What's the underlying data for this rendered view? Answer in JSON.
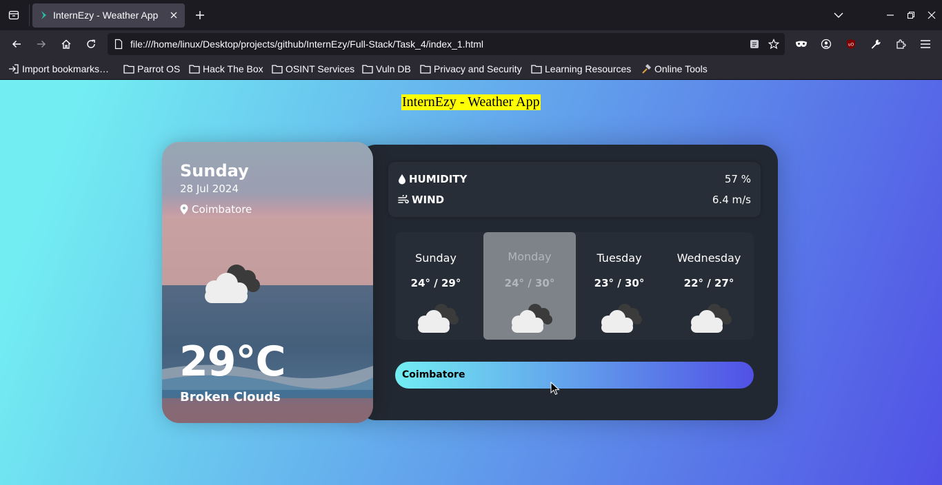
{
  "browser": {
    "tab_title": "InternEzy - Weather App",
    "url": "file:///home/linux/Desktop/projects/github/InternEzy/Full-Stack/Task_4/index_1.html",
    "bookmarks": [
      {
        "label": "Import bookmarks…"
      },
      {
        "label": "Parrot OS"
      },
      {
        "label": "Hack The Box"
      },
      {
        "label": "OSINT Services"
      },
      {
        "label": "Vuln DB"
      },
      {
        "label": "Privacy and Security"
      },
      {
        "label": "Learning Resources"
      },
      {
        "label": "Online Tools"
      }
    ]
  },
  "app": {
    "title": "InternEzy - Weather App",
    "today": {
      "day": "Sunday",
      "date": "28 Jul 2024",
      "location": "Coimbatore",
      "temperature": "29°C",
      "description": "Broken Clouds"
    },
    "stats": {
      "humidity_label": "HUMIDITY",
      "humidity_value": "57 %",
      "wind_label": "WIND",
      "wind_value": "6.4 m/s"
    },
    "forecast": [
      {
        "day": "Sunday",
        "temp": "24° / 29°"
      },
      {
        "day": "Monday",
        "temp": "24° / 30°"
      },
      {
        "day": "Tuesday",
        "temp": "23° / 30°"
      },
      {
        "day": "Wednesday",
        "temp": "22° / 27°"
      }
    ],
    "active_forecast_index": 1,
    "search_value": "Coimbatore"
  },
  "colors": {
    "bg_gradient_start": "#72edf2",
    "bg_gradient_end": "#5151e5",
    "card_dark": "#222831",
    "title_highlight": "#ffff00"
  }
}
